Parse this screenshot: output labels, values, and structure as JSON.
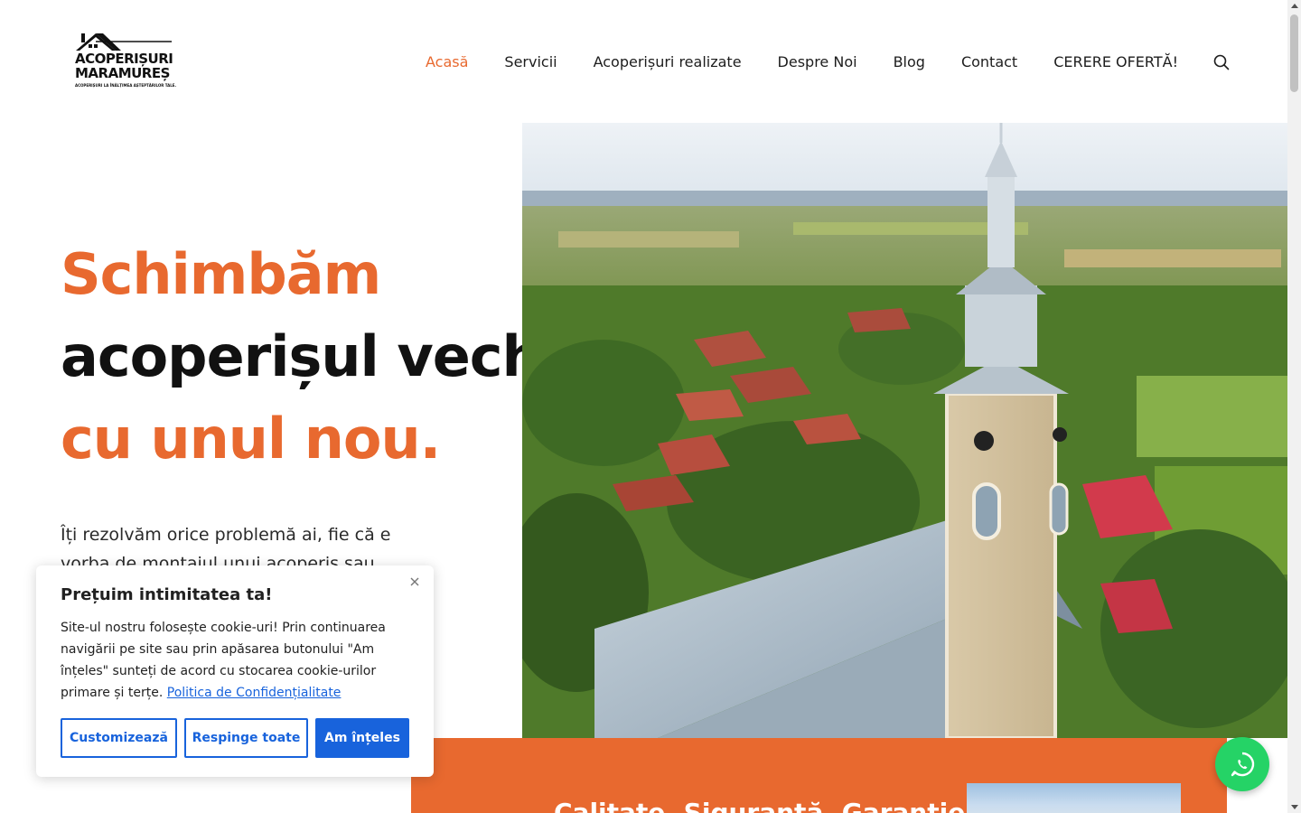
{
  "header": {
    "logo": {
      "line1": "ACOPERIȘURI",
      "line2": "MARAMUREȘ",
      "tagline": "ACOPERIȘURI LA ÎNĂLȚIMEA AȘTEPTĂRILOR TALE."
    },
    "nav": [
      {
        "label": "Acasă",
        "active": true
      },
      {
        "label": "Servicii",
        "active": false
      },
      {
        "label": "Acoperișuri realizate",
        "active": false
      },
      {
        "label": "Despre Noi",
        "active": false
      },
      {
        "label": "Blog",
        "active": false
      },
      {
        "label": "Contact",
        "active": false
      },
      {
        "label": "CERERE OFERTĂ!",
        "active": false
      }
    ],
    "search_icon": "search-icon"
  },
  "hero": {
    "title_line1": "Schimbăm",
    "title_line2": "acoperișul vechi",
    "title_line3": "cu unul nou.",
    "text": "Îți rezolvăm orice problemă ai, fie că e vorba de montajul unui acoperiș sau"
  },
  "band": {
    "title": "Calitate. Siguranță. Garanție."
  },
  "cookie": {
    "title": "Prețuim intimitatea ta!",
    "text": "Site-ul nostru folosește cookie-uri! Prin continuarea navigării pe site sau prin apăsarea butonului \"Am înțeles\" sunteți de acord cu stocarea cookie-urilor primare și terțe.",
    "link": "Politica de Confidențialitate",
    "buttons": {
      "customize": "Customizează",
      "reject": "Respinge toate",
      "accept": "Am înțeles"
    }
  },
  "colors": {
    "accent": "#e8692f",
    "cookie_blue": "#1863dc",
    "whatsapp": "#25d366"
  }
}
